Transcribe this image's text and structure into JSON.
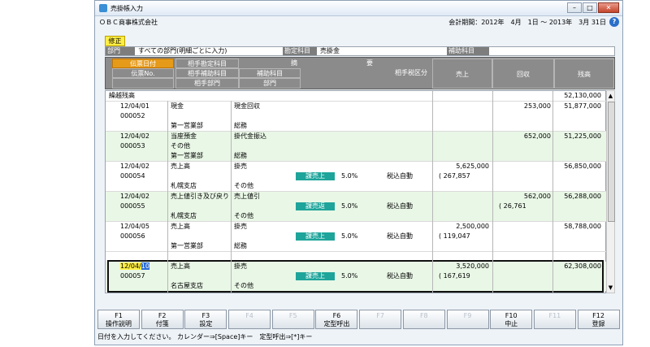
{
  "window": {
    "title": "売掛帳入力",
    "buttons": [
      "–",
      "□",
      "✕"
    ]
  },
  "company": {
    "name": "ＯＢＣ商事株式会社",
    "period": "会計期間：2012年　4月　1日 ～ 2013年　3月 31日"
  },
  "mode": "修正",
  "filter": {
    "dept_label": "部門",
    "dept_value": "すべての部門(明細ごとに入力)",
    "account_label": "勘定科目",
    "account_value": "売掛金",
    "subaccount_label": "補助科目",
    "subaccount_value": ""
  },
  "headers": {
    "date": "伝票日付",
    "no": "伝票No.",
    "contra_account": "相手勘定科目",
    "contra_sub": "相手補助科目",
    "sub": "補助科目",
    "contra_dept": "相手部門",
    "dept": "部門",
    "summary_a": "摘",
    "summary_b": "要",
    "tax": "相手税区分",
    "sales": "売上",
    "collection": "回収",
    "balance": "残高"
  },
  "carryover": {
    "label": "繰越残高",
    "balance": "52,130,000"
  },
  "entries": [
    {
      "date": "12/04/01",
      "no": "000052",
      "account": "現金",
      "summary": "現金回収",
      "sub": "",
      "dept": "第一営業部",
      "dept2": "総務",
      "sales": "",
      "tax_tag": "",
      "rate": "",
      "mode": "",
      "tax_amt": "",
      "collection": "253,000",
      "balance": "51,877,000"
    },
    {
      "date": "12/04/02",
      "no": "000053",
      "account": "当座預金",
      "summary": "掛代金振込",
      "sub": "その他",
      "dept": "第一営業部",
      "dept2": "総務",
      "sales": "",
      "tax_tag": "",
      "rate": "",
      "mode": "",
      "tax_amt": "",
      "collection": "652,000",
      "balance": "51,225,000"
    },
    {
      "date": "12/04/02",
      "no": "000054",
      "account": "売上高",
      "summary": "掛売",
      "sub": "",
      "dept": "札幌支店",
      "dept2": "その他",
      "sales": "5,625,000",
      "tax_tag": "課売上",
      "rate": "5.0%",
      "mode": "税込自動",
      "tax_amt": "( 267,857",
      "collection": "",
      "balance": "56,850,000"
    },
    {
      "date": "12/04/02",
      "no": "000055",
      "account": "売上値引き及び戻り",
      "summary": "売上値引",
      "sub": "",
      "dept": "札幌支店",
      "dept2": "その他",
      "sales": "",
      "tax_tag": "課売返",
      "rate": "5.0%",
      "mode": "税込自動",
      "tax_amt": "( 26,761",
      "collection": "562,000",
      "balance": "56,288,000"
    },
    {
      "date": "12/04/05",
      "no": "000056",
      "account": "売上高",
      "summary": "掛売",
      "sub": "",
      "dept": "第一営業部",
      "dept2": "総務",
      "sales": "2,500,000",
      "tax_tag": "課売上",
      "rate": "5.0%",
      "mode": "税込自動",
      "tax_amt": "( 119,047",
      "collection": "",
      "balance": "58,788,000"
    },
    {
      "date": "12/04/10",
      "no": "000057",
      "account": "売上高",
      "summary": "掛売",
      "sub": "",
      "dept": "名古屋支店",
      "dept2": "その他",
      "sales": "3,520,000",
      "tax_tag": "課売上",
      "rate": "5.0%",
      "mode": "税込自動",
      "tax_amt": "( 167,619",
      "collection": "",
      "balance": "62,308,000"
    }
  ],
  "current_date": {
    "prefix": "12/04/",
    "day": "10"
  },
  "fkeys": [
    {
      "key": "F1",
      "label": "操作説明",
      "enabled": true
    },
    {
      "key": "F2",
      "label": "付箋",
      "enabled": true
    },
    {
      "key": "F3",
      "label": "設定",
      "enabled": true
    },
    {
      "key": "F4",
      "label": "",
      "enabled": false
    },
    {
      "key": "F5",
      "label": "",
      "enabled": false
    },
    {
      "key": "F6",
      "label": "定型呼出",
      "enabled": true
    },
    {
      "key": "F7",
      "label": "",
      "enabled": false
    },
    {
      "key": "F8",
      "label": "",
      "enabled": false
    },
    {
      "key": "F9",
      "label": "",
      "enabled": false
    },
    {
      "key": "F10",
      "label": "中止",
      "enabled": true
    },
    {
      "key": "F11",
      "label": "",
      "enabled": false
    },
    {
      "key": "F12",
      "label": "登録",
      "enabled": true
    }
  ],
  "status": "日付を入力してください。 カレンダー⇒[Space]キー　定型呼出⇒[*]キー",
  "colors": {
    "tax_tag": "#1ea49a",
    "header": "#8b8b8b",
    "highlight": "#ffee44",
    "row_green": "#e9f7e6"
  }
}
